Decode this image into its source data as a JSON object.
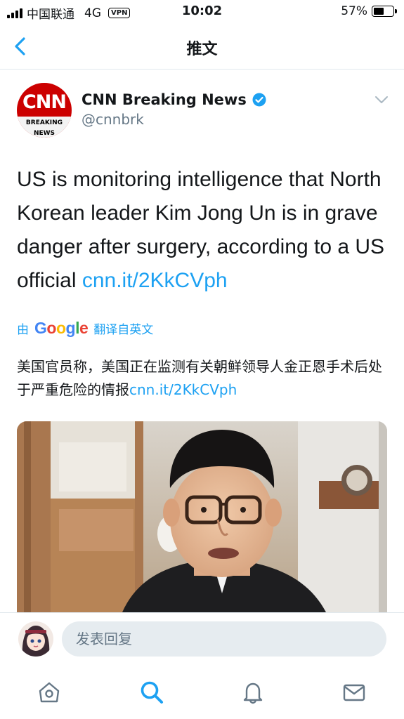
{
  "status_bar": {
    "carrier": "中国联通",
    "network": "4G",
    "vpn": "VPN",
    "time": "10:02",
    "battery_percent": "57%",
    "battery_level": 0.57
  },
  "nav": {
    "title": "推文",
    "back_icon": "chevron-left-icon"
  },
  "tweet": {
    "author_name": "CNN Breaking News",
    "author_handle": "@cnnbrk",
    "avatar_logo_text": "CNN",
    "avatar_band_line1": "BREAKING",
    "avatar_band_line2": "NEWS",
    "text": "US is monitoring intelligence that North Korean leader Kim Jong Un is in grave danger after surgery, according to a US official ",
    "link": "cnn.it/2KkCVph",
    "translate_prefix": "由",
    "translate_brand": "Google",
    "translate_suffix": "翻译自英文",
    "translated_text": "美国官员称，美国正在监测有关朝鲜领导人金正恩手术后处于严重危险的情报",
    "translated_link": "cnn.it/2KkCVph"
  },
  "reply": {
    "placeholder": "发表回复"
  },
  "tabs": [
    {
      "icon": "home-icon"
    },
    {
      "icon": "search-icon"
    },
    {
      "icon": "bell-icon"
    },
    {
      "icon": "mail-icon"
    }
  ],
  "colors": {
    "accent": "#1da1f2",
    "cnn_red": "#cc0000",
    "secondary_text": "#657786"
  }
}
